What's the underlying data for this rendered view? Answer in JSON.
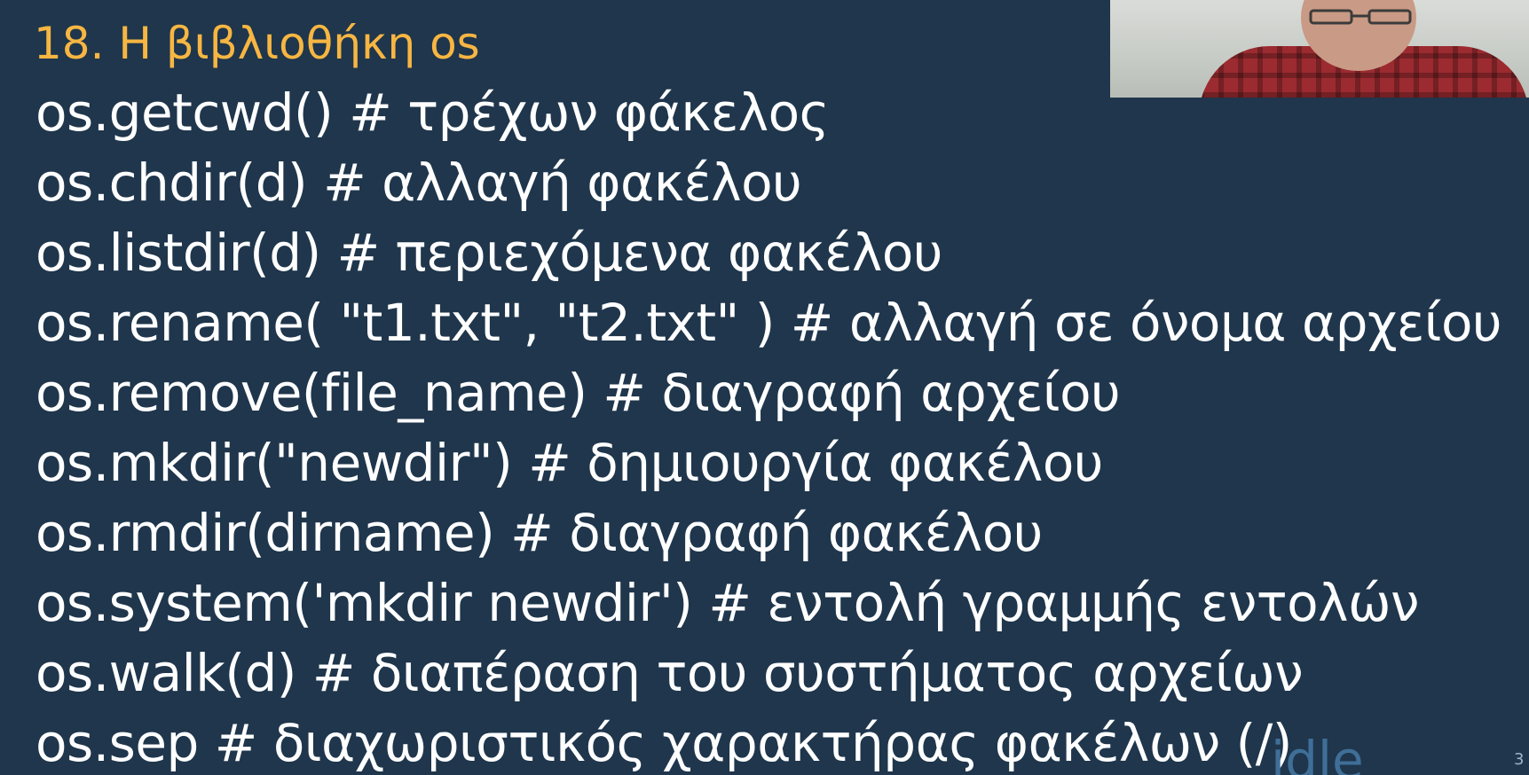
{
  "slide": {
    "title": "18. Η βιβλιοθήκη os",
    "lines": [
      "os.getcwd() # τρέχων φάκελος",
      "os.chdir(d) # αλλαγή φακέλου",
      "os.listdir(d) # περιεχόμενα φακέλου",
      "os.rename( \"t1.txt\", \"t2.txt\" ) # αλλαγή σε όνομα αρχείου",
      "os.remove(file_name) # διαγραφή αρχείου",
      "os.mkdir(\"newdir\") # δημιουργία φακέλου",
      "os.rmdir(dirname) # διαγραφή φακέλου",
      "os.system('mkdir newdir') # εντολή γραμμής εντολών",
      "os.walk(d) # διαπέραση του συστήματος αρχείων",
      "os.sep #  διαχωριστικός χαρακτήρας φακέλων (/)"
    ],
    "ghost_text": "idle",
    "page_number": "3"
  },
  "colors": {
    "background": "#1f364c",
    "title": "#f7b642",
    "text": "#ffffff"
  },
  "icons": {
    "webcam": "presenter-webcam-overlay"
  }
}
